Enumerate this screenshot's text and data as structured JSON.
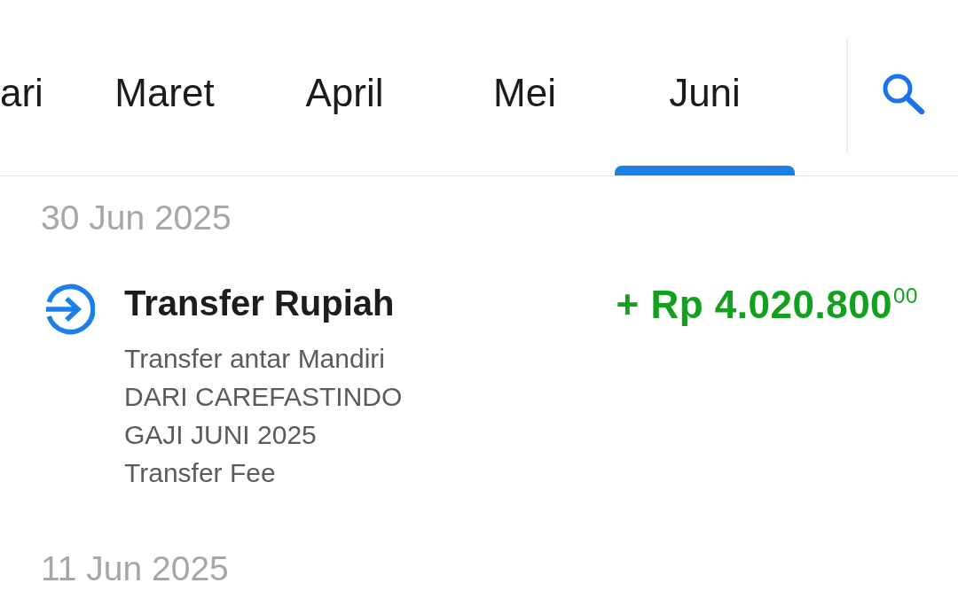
{
  "tabs": [
    {
      "label": "ari",
      "selected": false
    },
    {
      "label": "Maret",
      "selected": false
    },
    {
      "label": "April",
      "selected": false
    },
    {
      "label": "Mei",
      "selected": false
    },
    {
      "label": "Juni",
      "selected": true
    }
  ],
  "transaction_groups": [
    {
      "date": "30 Jun 2025",
      "transactions": [
        {
          "title": "Transfer Rupiah",
          "details": [
            "Transfer antar Mandiri",
            "DARI CAREFASTINDO",
            "GAJI JUNI 2025",
            "Transfer Fee"
          ],
          "amount": "+ Rp 4.020.800$^{00}$"
        }
      ]
    },
    {
      "date": "11 Jun 2025"
    }
  ]
}
